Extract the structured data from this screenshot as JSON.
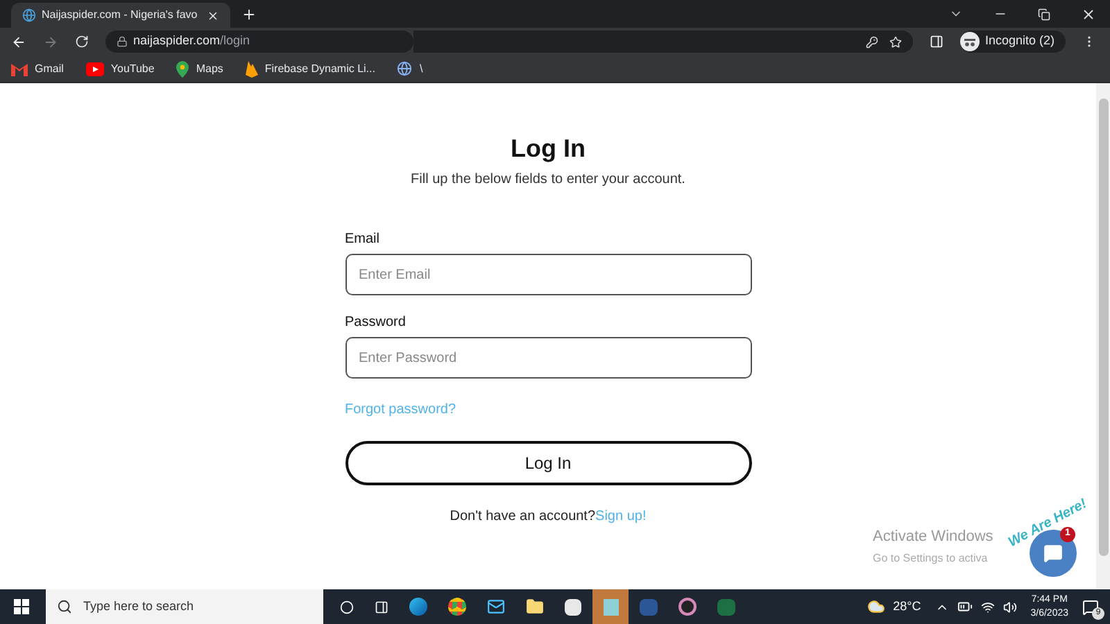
{
  "browser": {
    "tab_title": "Naijaspider.com - Nigeria's favo",
    "url_host": "naijaspider.com",
    "url_path": "/login",
    "profile": "Incognito (2)",
    "bookmarks": [
      {
        "kind": "gmail",
        "label": "Gmail"
      },
      {
        "kind": "youtube",
        "label": "YouTube"
      },
      {
        "kind": "maps",
        "label": "Maps"
      },
      {
        "kind": "firebase",
        "label": "Firebase Dynamic Li..."
      },
      {
        "kind": "globe",
        "label": "\\"
      }
    ]
  },
  "page": {
    "title": "Log In",
    "subtitle": "Fill up the below fields to enter your account.",
    "fields": [
      {
        "label": "Email",
        "placeholder": "Enter Email"
      },
      {
        "label": "Password",
        "placeholder": "Enter Password"
      }
    ],
    "forgot_link": "Forgot password?",
    "submit": "Log In",
    "signup_prompt": "Don't have an account?",
    "signup_link": "Sign up!"
  },
  "chat_widget": {
    "banner": "We Are Here!",
    "badge": "1"
  },
  "activation": {
    "title": "Activate Windows",
    "hint": "Go to Settings to activa"
  },
  "taskbar": {
    "search_placeholder": "Type here to search",
    "weather": "28°C",
    "time": "7:44 PM",
    "date": "3/6/2023",
    "notifications": "9"
  }
}
